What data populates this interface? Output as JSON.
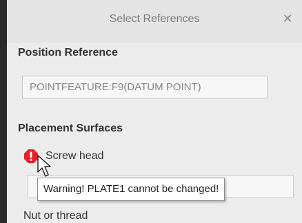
{
  "dialog": {
    "title": "Select References",
    "close_glyph": "✕"
  },
  "position_reference": {
    "heading": "Position Reference",
    "value": "POINTFEATURE:F9(DATUM POINT)"
  },
  "placement_surfaces": {
    "heading": "Placement Surfaces",
    "screw_head_label": "Screw head",
    "screw_head_status_icon": "warning-icon",
    "nut_label": "Nut or thread"
  },
  "tooltip": {
    "text": "Warning! PLATE1 cannot be changed!"
  },
  "colors": {
    "warning": "#e52228",
    "dialog_bg": "#ececec",
    "titlebar_bg": "#e4e4e4"
  }
}
